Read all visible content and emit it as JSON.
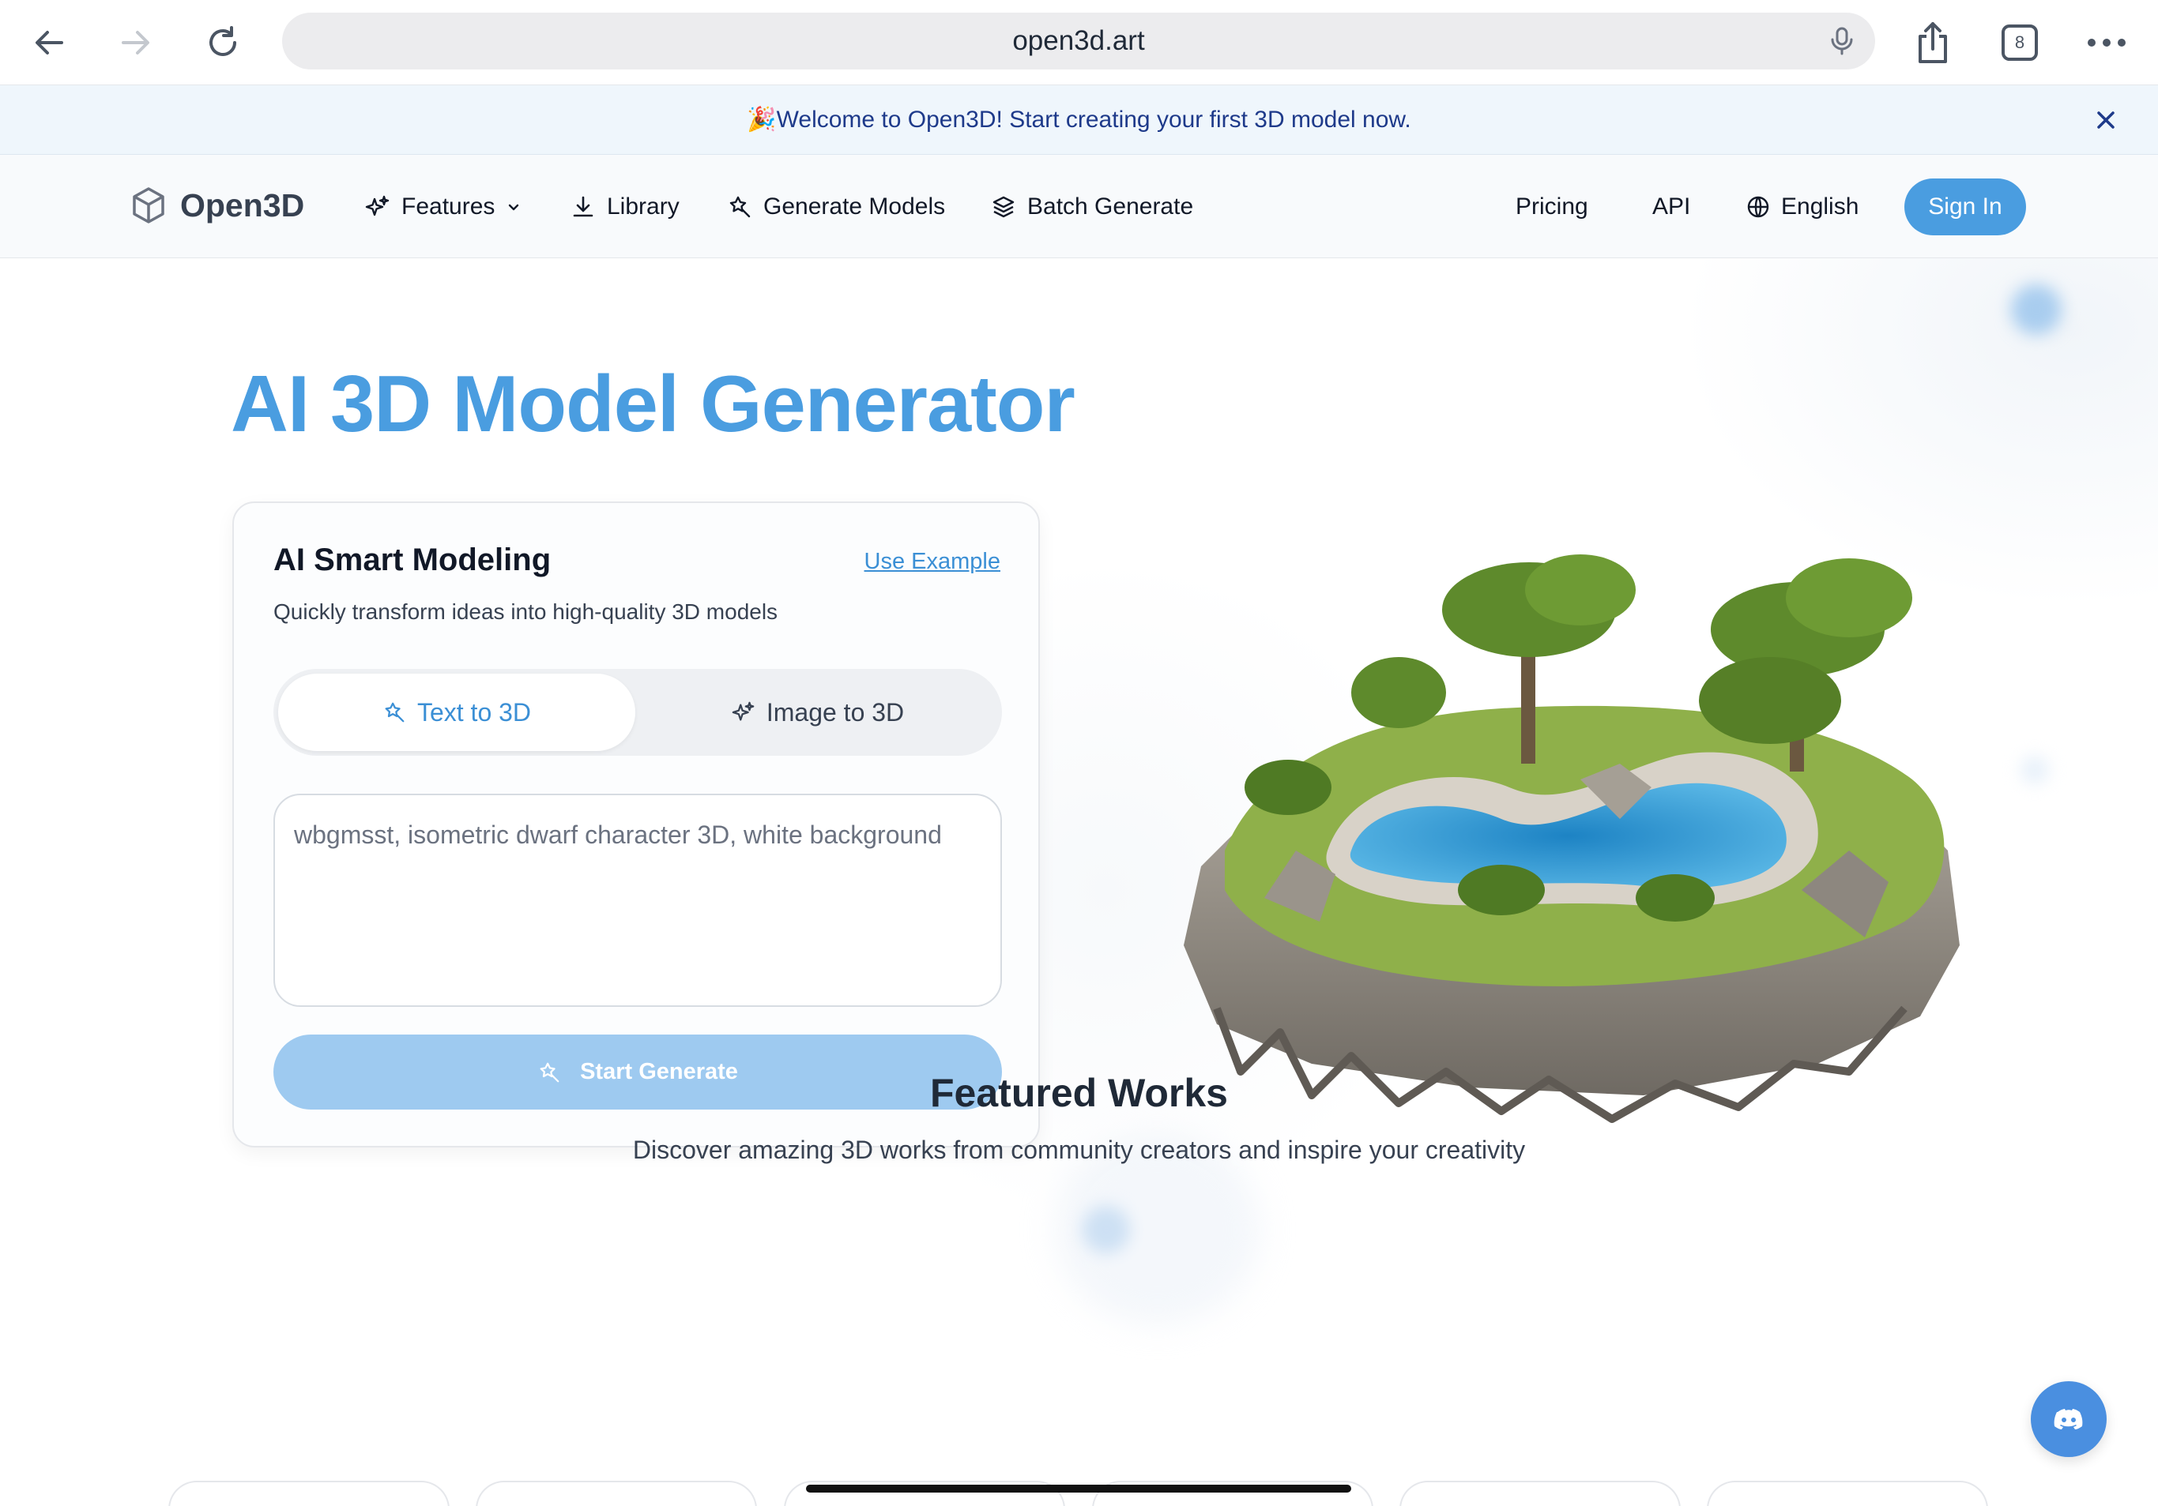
{
  "browser": {
    "url": "open3d.art",
    "tab_count": "8"
  },
  "banner": {
    "emoji": "🎉",
    "text": "Welcome to Open3D! Start creating your first 3D model now."
  },
  "nav": {
    "logo": "Open3D",
    "items": [
      {
        "label": "Features",
        "icon": "sparkles-icon"
      },
      {
        "label": "Library",
        "icon": "download-icon"
      },
      {
        "label": "Generate Models",
        "icon": "magic-wand-icon"
      },
      {
        "label": "Batch Generate",
        "icon": "layers-icon"
      }
    ],
    "pricing": "Pricing",
    "api": "API",
    "language": "English",
    "sign_in": "Sign In"
  },
  "hero": {
    "title": "AI 3D Model Generator"
  },
  "card": {
    "title": "AI Smart Modeling",
    "use_example": "Use Example",
    "subtitle": "Quickly transform ideas into high-quality 3D models",
    "tabs": [
      {
        "label": "Text to 3D",
        "active": true,
        "icon": "magic-wand-icon"
      },
      {
        "label": "Image to 3D",
        "active": false,
        "icon": "sparkles-icon"
      }
    ],
    "prompt_placeholder": "wbgmsst, isometric dwarf character 3D, white background",
    "generate_label": "Start Generate"
  },
  "featured": {
    "title": "Featured Works",
    "subtitle": "Discover amazing 3D works from community creators and inspire your creativity"
  },
  "colors": {
    "accent": "#4a9de0",
    "accent_light": "#9ecaf0",
    "banner_bg": "#eff6fc",
    "discord": "#4a8fe0"
  }
}
